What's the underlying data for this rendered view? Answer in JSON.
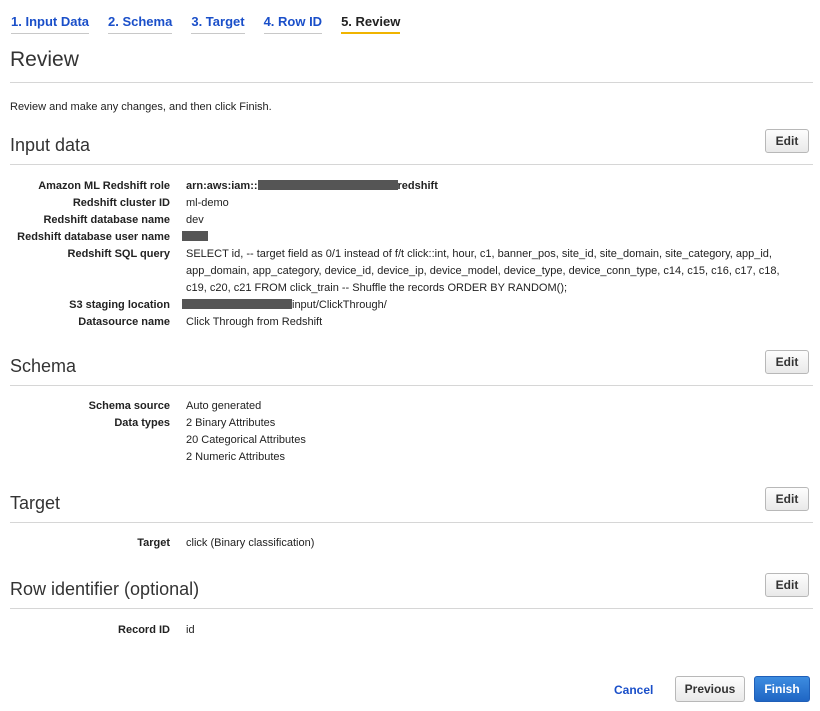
{
  "wizard": {
    "steps": [
      {
        "label": "1. Input Data"
      },
      {
        "label": "2. Schema"
      },
      {
        "label": "3. Target"
      },
      {
        "label": "4. Row ID"
      },
      {
        "label": "5. Review"
      }
    ],
    "active_step": "5. Review"
  },
  "page": {
    "title": "Review",
    "intro": "Review and make any changes, and then click Finish."
  },
  "sections": {
    "input_data": {
      "title": "Input data",
      "edit_label": "Edit",
      "rows": [
        {
          "label": "Amazon ML Redshift role",
          "value_prefix": "arn:aws:iam::",
          "value_suffix": "redshift"
        },
        {
          "label": "Redshift cluster ID",
          "value": "ml-demo"
        },
        {
          "label": "Redshift database name",
          "value": "dev"
        },
        {
          "label": "Redshift database user name",
          "value": ""
        },
        {
          "label": "Redshift SQL query",
          "value": "SELECT id, -- target field as 0/1 instead of f/t click::int, hour, c1, banner_pos, site_id, site_domain, site_category, app_id, app_domain, app_category, device_id, device_ip, device_model, device_type, device_conn_type, c14, c15, c16, c17, c18, c19, c20, c21 FROM click_train -- Shuffle the records ORDER BY RANDOM();"
        },
        {
          "label": "S3 staging location",
          "value_suffix": "input/ClickThrough/"
        },
        {
          "label": "Datasource name",
          "value": "Click Through from Redshift"
        }
      ]
    },
    "schema": {
      "title": "Schema",
      "edit_label": "Edit",
      "rows": [
        {
          "label": "Schema source",
          "value": "Auto generated"
        },
        {
          "label": "Data types",
          "values": [
            "2 Binary Attributes",
            "20 Categorical Attributes",
            "2 Numeric Attributes"
          ]
        }
      ]
    },
    "target": {
      "title": "Target",
      "edit_label": "Edit",
      "rows": [
        {
          "label": "Target",
          "value": "click (Binary classification)"
        }
      ]
    },
    "row_identifier": {
      "title": "Row identifier (optional)",
      "edit_label": "Edit",
      "rows": [
        {
          "label": "Record ID",
          "value": "id"
        }
      ]
    }
  },
  "footer": {
    "cancel_label": "Cancel",
    "previous_label": "Previous",
    "finish_label": "Finish"
  },
  "colors": {
    "link": "#1a4fc9",
    "active_underline": "#f0b400",
    "primary_button": "#1f66c4",
    "redaction": "#555555"
  }
}
